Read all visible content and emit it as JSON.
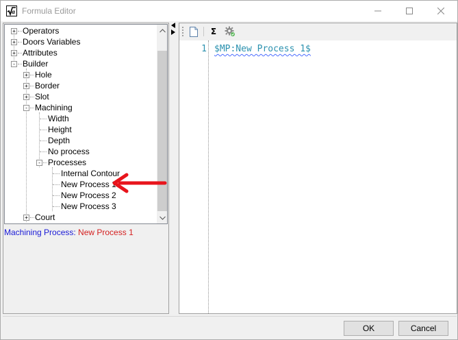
{
  "window": {
    "title": "Formula Editor",
    "icon": "formula-sqrt-icon"
  },
  "tree": {
    "items": [
      {
        "label": "Operators",
        "expander": "+"
      },
      {
        "label": "Doors Variables",
        "expander": "+"
      },
      {
        "label": "Attributes",
        "expander": "+"
      },
      {
        "label": "Builder",
        "expander": "-"
      },
      {
        "label": "Hole",
        "expander": "+"
      },
      {
        "label": "Border",
        "expander": "+"
      },
      {
        "label": "Slot",
        "expander": "+"
      },
      {
        "label": "Machining",
        "expander": "-"
      },
      {
        "label": "Width"
      },
      {
        "label": "Height"
      },
      {
        "label": "Depth"
      },
      {
        "label": "No process"
      },
      {
        "label": "Processes",
        "expander": "-"
      },
      {
        "label": "Internal Contour"
      },
      {
        "label": "New Process 1",
        "selected": true
      },
      {
        "label": "New Process 2"
      },
      {
        "label": "New Process 3"
      },
      {
        "label": "Court",
        "expander": "+"
      }
    ]
  },
  "description": {
    "label": "Machining Process: ",
    "value": "New Process 1"
  },
  "toolbar": {
    "sum_label": "Σ"
  },
  "editor": {
    "line_number": "1",
    "code": "$MP:New Process 1$"
  },
  "buttons": {
    "ok": "OK",
    "cancel": "Cancel"
  },
  "colors": {
    "code_text": "#2b91af",
    "description_label": "#1a1ad6",
    "description_value": "#d42020",
    "annotation_arrow": "#e8141c"
  }
}
